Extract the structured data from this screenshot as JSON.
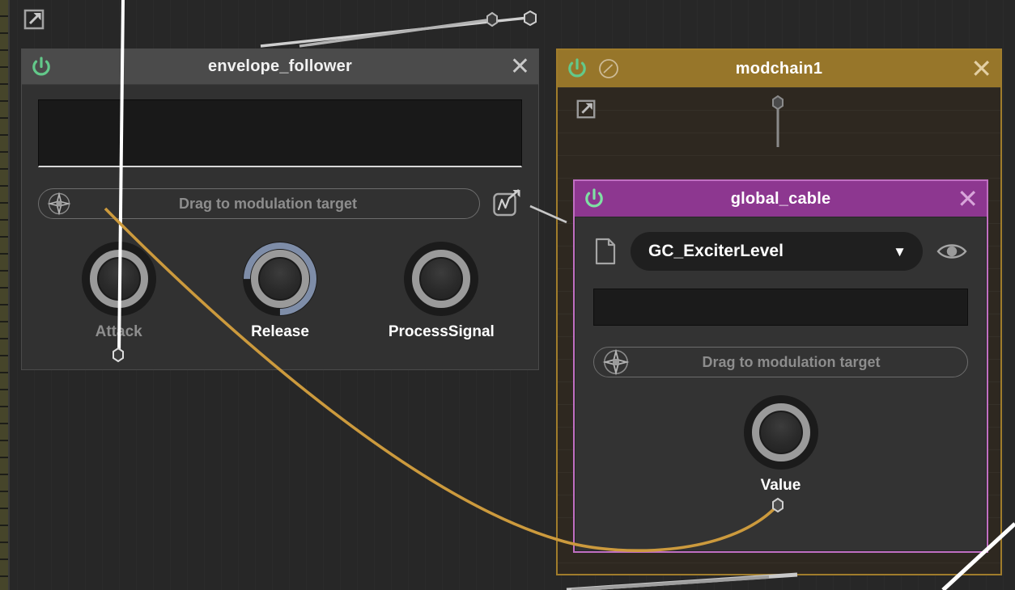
{
  "canvas": {
    "background_color": "#272727",
    "ruler_color": "#46452a"
  },
  "toolbar": {
    "open_external_icon": "external-link-icon"
  },
  "panels": {
    "envelope_follower": {
      "title": "envelope_follower",
      "header_color": "#4b4b4b",
      "body_color": "#313131",
      "power_icon": "power-icon",
      "power_color": "#63c98a",
      "close_label": "✕",
      "scope_label": "",
      "modulation": {
        "target_icon": "modulation-target-icon",
        "placeholder": "Drag to modulation target",
        "curve_icon": "modulation-curve-icon"
      },
      "knobs": [
        {
          "label": "Attack",
          "dim": true,
          "arc": false
        },
        {
          "label": "Release",
          "dim": false,
          "arc": true
        },
        {
          "label": "ProcessSignal",
          "dim": false,
          "arc": false
        }
      ]
    },
    "modchain1": {
      "title": "modchain1",
      "header_color": "#97762a",
      "border_color": "#a07c2b",
      "body_color": "#2e2820",
      "power_icon": "power-icon",
      "power_color": "#63c98a",
      "meter_icon": "gauge-icon",
      "close_label": "✕",
      "open_external_icon": "external-link-icon"
    },
    "global_cable": {
      "title": "global_cable",
      "header_color": "#8d3790",
      "border_color": "#c06fc2",
      "body_color": "#333333",
      "power_icon": "power-icon",
      "power_color": "#63c98a",
      "close_label": "✕",
      "document_icon": "document-icon",
      "visibility_icon": "eye-icon",
      "select": {
        "value": "GC_ExciterLevel",
        "caret": "▼",
        "options": [
          "GC_ExciterLevel"
        ]
      },
      "modulation": {
        "target_icon": "modulation-target-icon",
        "placeholder": "Drag to modulation target"
      },
      "knobs": [
        {
          "label": "Value",
          "dim": false,
          "arc": false
        }
      ]
    }
  },
  "cables": [
    {
      "name": "modulation-cable-attack",
      "color": "#cc9a3d"
    },
    {
      "name": "signal-cable-top",
      "color": "#cfcfcf"
    },
    {
      "name": "signal-cable-white",
      "color": "#ffffff"
    },
    {
      "name": "signal-cable-bottom",
      "color": "#b8b8b8"
    },
    {
      "name": "modchain-input-cable",
      "color": "#8a8a8a"
    }
  ]
}
